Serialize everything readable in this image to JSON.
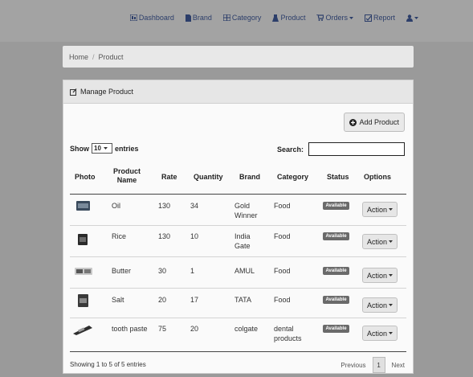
{
  "nav": {
    "items": [
      {
        "label": "Dashboard",
        "icon": "dashboard-icon"
      },
      {
        "label": "Brand",
        "icon": "brand-icon"
      },
      {
        "label": "Category",
        "icon": "category-icon"
      },
      {
        "label": "Product",
        "icon": "product-icon"
      },
      {
        "label": "Orders",
        "icon": "cart-icon",
        "dropdown": true
      },
      {
        "label": "Report",
        "icon": "report-icon"
      }
    ],
    "user_icon": "user-icon"
  },
  "breadcrumb": {
    "home": "Home",
    "sep": "/",
    "current": "Product"
  },
  "panel": {
    "title": "Manage Product",
    "title_icon": "edit-icon"
  },
  "add_button": {
    "label": "Add Product",
    "icon": "plus-circle-icon"
  },
  "table_controls": {
    "show_label": "Show",
    "length_value": "10",
    "entries_label": "entries",
    "search_label": "Search:",
    "search_value": ""
  },
  "table": {
    "columns": [
      "Photo",
      "Product Name",
      "Rate",
      "Quantity",
      "Brand",
      "Category",
      "Status",
      "Options"
    ],
    "rows": [
      {
        "photo": "product-image-oil",
        "name": "Oil",
        "rate": "130",
        "quantity": "34",
        "brand": "Gold Winner",
        "category": "Food",
        "status": "Available",
        "option": "Action"
      },
      {
        "photo": "product-image-rice",
        "name": "Rice",
        "rate": "130",
        "quantity": "10",
        "brand": "India Gate",
        "category": "Food",
        "status": "Available",
        "option": "Action"
      },
      {
        "photo": "product-image-butter",
        "name": "Butter",
        "rate": "30",
        "quantity": "1",
        "brand": "AMUL",
        "category": "Food",
        "status": "Available",
        "option": "Action"
      },
      {
        "photo": "product-image-salt",
        "name": "Salt",
        "rate": "20",
        "quantity": "17",
        "brand": "TATA",
        "category": "Food",
        "status": "Available",
        "option": "Action"
      },
      {
        "photo": "product-image-toothpaste",
        "name": "tooth paste",
        "rate": "75",
        "quantity": "20",
        "brand": "colgate",
        "category": "dental products",
        "status": "Available",
        "option": "Action"
      }
    ]
  },
  "footer": {
    "info": "Showing 1 to 5 of 5 entries",
    "previous": "Previous",
    "page": "1",
    "next": "Next"
  },
  "colors": {
    "nav_text": "#2c3e6a",
    "badge": "#6a6a6a",
    "background": "#9a9a9a"
  }
}
